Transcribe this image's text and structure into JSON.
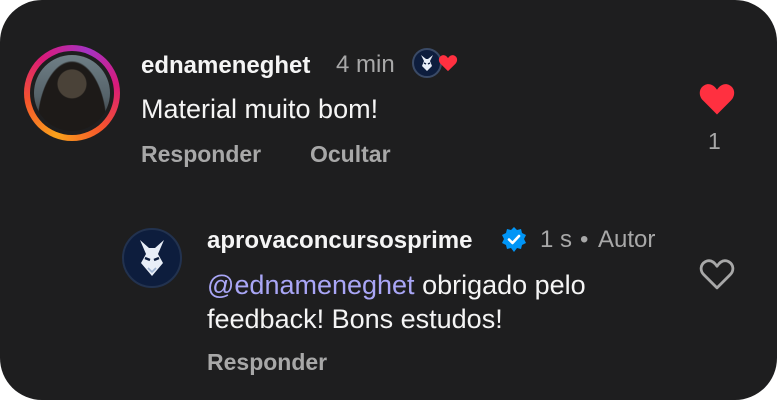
{
  "comment": {
    "username": "ednameneghet",
    "time": "4 min",
    "text": "Material muito bom!",
    "reply_label": "Responder",
    "hide_label": "Ocultar",
    "like_count": "1"
  },
  "reply": {
    "username": "aprovaconcursosprime",
    "time": "1 s",
    "separator": "•",
    "author_tag": "Autor",
    "mention": "@ednameneghet",
    "text_line1": " obrigado pelo",
    "text_line2": "feedback! Bons estudos!",
    "reply_label": "Responder"
  },
  "icons": {
    "liked": "heart-filled-icon",
    "unliked": "heart-outline-icon",
    "verified": "verified-badge-icon"
  },
  "colors": {
    "background": "#1e1e1f",
    "heart": "#ff3040",
    "verified": "#0095f6",
    "mention": "#a9a6f6",
    "muted": "#a8a8a8"
  }
}
